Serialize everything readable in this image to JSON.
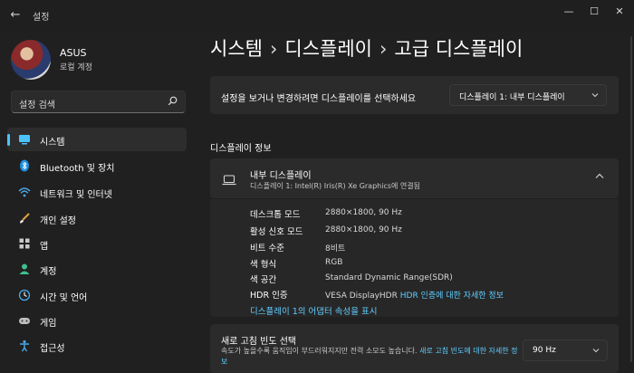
{
  "window": {
    "title": "설정",
    "back_glyph": "←",
    "minimize_glyph": "—",
    "maximize_glyph": "☐",
    "close_glyph": "✕"
  },
  "user": {
    "name": "ASUS",
    "account": "로컬 계정"
  },
  "search": {
    "placeholder": "설정 검색"
  },
  "sidebar": {
    "items": [
      {
        "label": "시스템",
        "icon": "monitor-icon",
        "active": true
      },
      {
        "label": "Bluetooth 및 장치",
        "icon": "bluetooth-icon"
      },
      {
        "label": "네트워크 및 인터넷",
        "icon": "wifi-icon"
      },
      {
        "label": "개인 설정",
        "icon": "brush-icon"
      },
      {
        "label": "앱",
        "icon": "apps-icon"
      },
      {
        "label": "계정",
        "icon": "person-icon"
      },
      {
        "label": "시간 및 언어",
        "icon": "globe-clock-icon"
      },
      {
        "label": "게임",
        "icon": "gamepad-icon"
      },
      {
        "label": "접근성",
        "icon": "accessibility-icon"
      }
    ]
  },
  "breadcrumb": {
    "items": [
      "시스템",
      "디스플레이",
      "고급 디스플레이"
    ],
    "separator": "›"
  },
  "display_select": {
    "prompt": "설정을 보거나 변경하려면 디스플레이를 선택하세요",
    "value": "디스플레이 1: 내부 디스플레이"
  },
  "display_info": {
    "section_title": "디스플레이 정보",
    "title": "내부 디스플레이",
    "subtitle": "디스플레이 1: Intel(R) Iris(R) Xe Graphics에 연결됨",
    "rows": [
      {
        "label": "데스크톱 모드",
        "value": "2880×1800, 90 Hz"
      },
      {
        "label": "활성 신호 모드",
        "value": "2880×1800, 90 Hz"
      },
      {
        "label": "비트 수준",
        "value": "8비트"
      },
      {
        "label": "색 형식",
        "value": "RGB"
      },
      {
        "label": "색 공간",
        "value": "Standard Dynamic Range(SDR)"
      },
      {
        "label": "HDR 인증",
        "value": "VESA DisplayHDR",
        "link": "HDR 인증에 대한 자세한 정보"
      }
    ],
    "adapter_link": "디스플레이 1의 어댑터 속성을 표시"
  },
  "refresh_rate": {
    "title": "새로 고침 빈도 선택",
    "description": "속도가 높을수록 움직임이 부드러워지지만 전력 소모도 높습니다.",
    "link": "새로 고침 빈도에 대한 자세한 정보",
    "value": "90 Hz"
  },
  "colors": {
    "accent": "#4cc2ff",
    "link": "#60cdff",
    "background": "#202020",
    "card": "#2b2b2b"
  }
}
